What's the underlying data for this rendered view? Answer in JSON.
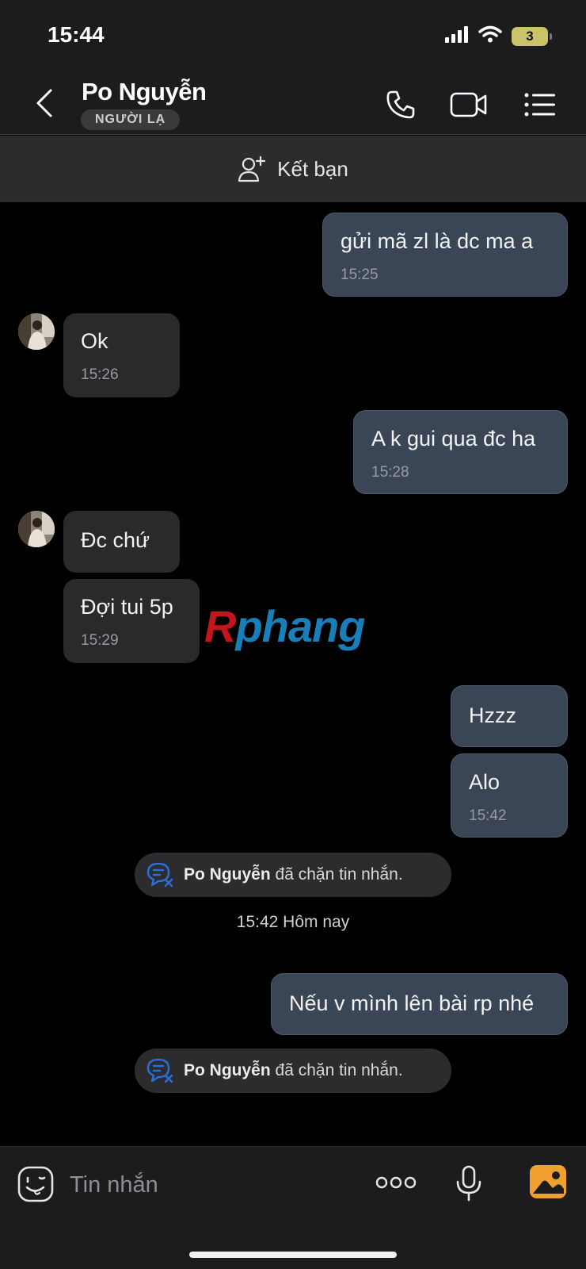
{
  "status_bar": {
    "time": "15:44",
    "battery_level": "3",
    "battery_color": "#c9c46a"
  },
  "header": {
    "contact_name": "Po Nguyễn",
    "badge": "NGƯỜI LẠ"
  },
  "add_friend": {
    "label": "Kết bạn"
  },
  "messages": [
    {
      "direction": "out",
      "text": "gửi mã zl là dc ma a",
      "time": "15:25"
    },
    {
      "direction": "in",
      "text": "Ok",
      "time": "15:26"
    },
    {
      "direction": "out",
      "text": "A k gui qua đc ha",
      "time": "15:28"
    },
    {
      "direction": "in",
      "text": "Đc chứ",
      "time": ""
    },
    {
      "direction": "in",
      "text": "Đợi tui 5p",
      "time": "15:29"
    },
    {
      "direction": "out",
      "text": "Hzzz",
      "time": ""
    },
    {
      "direction": "out",
      "text": "Alo",
      "time": "15:42"
    },
    {
      "direction": "out",
      "text": "Nếu v mình lên bài rp nhé",
      "time": ""
    }
  ],
  "system_notices": [
    {
      "name": "Po Nguyễn",
      "text": "đã chặn tin nhắn."
    },
    {
      "name": "Po Nguyễn",
      "text": "đã chặn tin nhắn."
    }
  ],
  "date_separator": "15:42 Hôm nay",
  "watermark": {
    "first": "R",
    "rest": "phang"
  },
  "input": {
    "placeholder": "Tin nhắn"
  },
  "colors": {
    "outgoing_bubble": "#3a4556",
    "incoming_bubble": "#2a2a2c",
    "accent_orange": "#f0a030"
  }
}
